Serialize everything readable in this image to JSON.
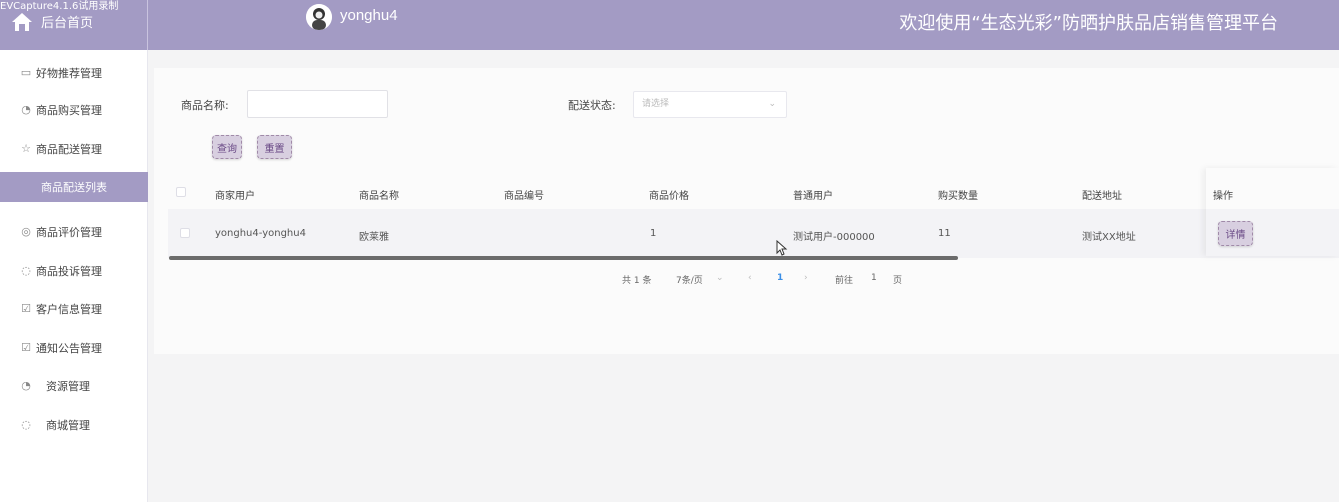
{
  "header": {
    "watermark": "EVCapture4.1.6试用录制",
    "home_label": "后台首页",
    "username": "yonghu4",
    "platform_title": "欢迎使用“生态光彩”防晒护肤品店销售管理平台"
  },
  "sidebar": {
    "items": [
      {
        "label": "好物推荐管理",
        "icon": "gift-icon"
      },
      {
        "label": "商品购买管理",
        "icon": "clock-icon"
      },
      {
        "label": "商品配送管理",
        "icon": "star-icon"
      },
      {
        "label": "商品配送列表",
        "icon": ""
      },
      {
        "label": "商品评价管理",
        "icon": "compass-icon"
      },
      {
        "label": "商品投诉管理",
        "icon": "power-icon"
      },
      {
        "label": "客户信息管理",
        "icon": "calendar-check-icon"
      },
      {
        "label": "通知公告管理",
        "icon": "calendar-check-icon"
      },
      {
        "label": "资源管理",
        "icon": "clock-icon"
      },
      {
        "label": "商城管理",
        "icon": "power-icon"
      }
    ]
  },
  "search": {
    "name_label": "商品名称:",
    "name_value": "",
    "status_label": "配送状态:",
    "status_placeholder": "请选择",
    "query_button": "查询",
    "reset_button": "重置"
  },
  "table": {
    "columns": [
      "商家用户",
      "商品名称",
      "商品编号",
      "商品价格",
      "普通用户",
      "购买数量",
      "配送地址",
      "操作"
    ],
    "rows": [
      {
        "merchant": "yonghu4-yonghu4",
        "product_name": "欧莱雅",
        "product_no": "",
        "price": "1",
        "user": "测试用户-000000",
        "quantity": "11",
        "address": "测试XX地址",
        "action": "详情"
      }
    ]
  },
  "pagination": {
    "total": "共 1 条",
    "page_size": "7条/页",
    "current_page": "1",
    "goto_label": "前往",
    "goto_value": "1",
    "page_suffix": "页"
  },
  "colors": {
    "accent": "#a39bc4",
    "button_bg": "#d8cfe0",
    "pager_active": "#3a8ee6"
  }
}
